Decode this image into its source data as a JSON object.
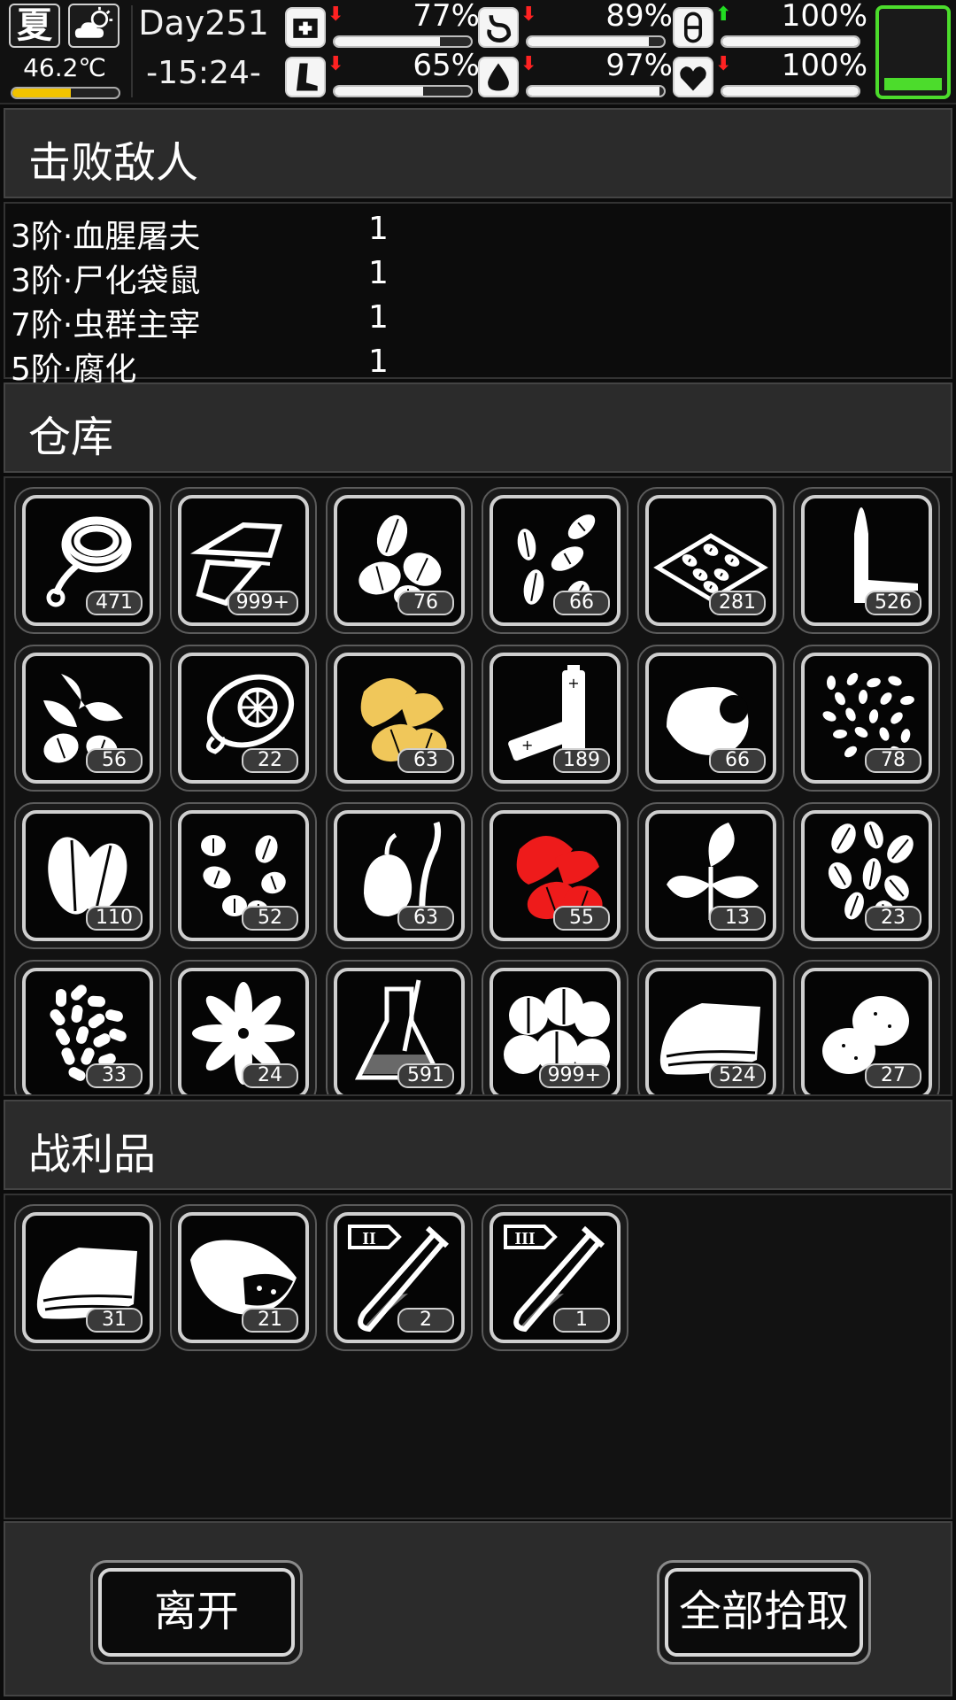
{
  "status": {
    "season": "夏",
    "weather_icon": "partly-cloudy-icon",
    "temperature": "46.2℃",
    "temperature_level": 0.55,
    "day": "Day251",
    "time": "-15:24-",
    "stats": [
      {
        "name": "health",
        "icon": "medkit-icon",
        "trend": "down",
        "value": "77%",
        "level": 0.77
      },
      {
        "name": "hunger",
        "icon": "stomach-icon",
        "trend": "down",
        "value": "89%",
        "level": 0.89
      },
      {
        "name": "pill",
        "icon": "pill-icon",
        "trend": "up",
        "value": "100%",
        "level": 1.0
      },
      {
        "name": "stamina",
        "icon": "leg-icon",
        "trend": "down",
        "value": "65%",
        "level": 0.65
      },
      {
        "name": "thirst",
        "icon": "water-drop-icon",
        "trend": "down",
        "value": "97%",
        "level": 0.97
      },
      {
        "name": "mood",
        "icon": "heart-icon",
        "trend": "down",
        "value": "100%",
        "level": 1.0
      }
    ],
    "colors": {
      "up": "#22dd22",
      "down": "#ff2222",
      "accent_green": "#4cdc2c",
      "temp": "#f3c400"
    }
  },
  "sections": {
    "enemies": "击败敌人",
    "storage": "仓库",
    "loot": "战利品"
  },
  "enemies": [
    {
      "name": "3阶·血腥屠夫",
      "count": "1"
    },
    {
      "name": "3阶·尸化袋鼠",
      "count": "1"
    },
    {
      "name": "7阶·虫群主宰",
      "count": "1"
    },
    {
      "name": "5阶·腐化",
      "count": "1"
    }
  ],
  "storage": [
    {
      "icon": "rope-icon",
      "count": "471"
    },
    {
      "icon": "cloth-scraps-icon",
      "count": "999+"
    },
    {
      "icon": "seeds-icon",
      "count": "76"
    },
    {
      "icon": "seeds-scattered-icon",
      "count": "66"
    },
    {
      "icon": "tray-seeds-icon",
      "count": "281"
    },
    {
      "icon": "bullet-icon",
      "count": "526"
    },
    {
      "icon": "herb-seeds-icon",
      "count": "56"
    },
    {
      "icon": "lemon-icon",
      "count": "22"
    },
    {
      "icon": "yellow-leaf-seeds-icon",
      "count": "63",
      "color": "#f0c75a"
    },
    {
      "icon": "battery-icon",
      "count": "189"
    },
    {
      "icon": "nut-meat-icon",
      "count": "66"
    },
    {
      "icon": "small-seeds-icon",
      "count": "78"
    },
    {
      "icon": "leaf-seed-icon",
      "count": "110"
    },
    {
      "icon": "beans-icon",
      "count": "52"
    },
    {
      "icon": "garlic-sprout-icon",
      "count": "63"
    },
    {
      "icon": "red-leaf-seeds-icon",
      "count": "55",
      "color": "#ee1b1b"
    },
    {
      "icon": "mint-leaf-icon",
      "count": "13"
    },
    {
      "icon": "sunflower-seeds-icon",
      "count": "23"
    },
    {
      "icon": "rice-grains-icon",
      "count": "33"
    },
    {
      "icon": "star-anise-icon",
      "count": "24"
    },
    {
      "icon": "flask-icon",
      "count": "591"
    },
    {
      "icon": "chestnuts-icon",
      "count": "999+"
    },
    {
      "icon": "folded-cloth-icon",
      "count": "524"
    },
    {
      "icon": "potatoes-icon",
      "count": "27"
    }
  ],
  "loot": [
    {
      "icon": "folded-cloth-icon",
      "count": "31"
    },
    {
      "icon": "meat-chunk-icon",
      "count": "21"
    },
    {
      "icon": "test-tube-ii-icon",
      "count": "2",
      "tier": "II"
    },
    {
      "icon": "test-tube-iii-icon",
      "count": "1",
      "tier": "III"
    }
  ],
  "buttons": {
    "leave": "离开",
    "pick_all": "全部拾取"
  }
}
